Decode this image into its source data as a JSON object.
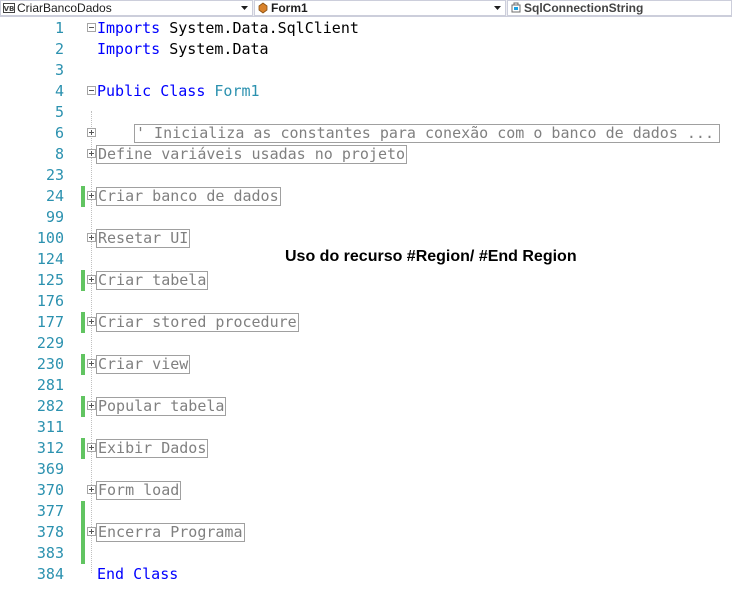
{
  "navbar": {
    "project_combo": "CriarBancoDados",
    "class_combo": "Form1",
    "member_combo": "SqlConnectionString",
    "project_icon": "vb-project-icon",
    "class_icon": "class-icon",
    "member_icon": "field-icon"
  },
  "editor": {
    "lines": [
      {
        "num": "1",
        "kw": "Imports",
        "rest": " System.Data.SqlClient"
      },
      {
        "num": "2",
        "kw": "Imports",
        "rest": " System.Data"
      },
      {
        "num": "3"
      },
      {
        "num": "4",
        "kw": "Public Class",
        "rest": " ",
        "name": "Form1"
      },
      {
        "num": "5"
      },
      {
        "num": "6",
        "collapsed": "' Inicializa as constantes para conexão com o banco de dados ..."
      },
      {
        "num": "8",
        "collapsed": "Define variáveis usadas no projeto"
      },
      {
        "num": "23"
      },
      {
        "num": "24",
        "collapsed": "Criar banco de dados"
      },
      {
        "num": "99"
      },
      {
        "num": "100",
        "collapsed": "Resetar UI"
      },
      {
        "num": "124"
      },
      {
        "num": "125",
        "collapsed": "Criar tabela"
      },
      {
        "num": "176"
      },
      {
        "num": "177",
        "collapsed": "Criar stored procedure"
      },
      {
        "num": "229"
      },
      {
        "num": "230",
        "collapsed": "Criar view"
      },
      {
        "num": "281"
      },
      {
        "num": "282",
        "collapsed": "Popular tabela"
      },
      {
        "num": "311"
      },
      {
        "num": "312",
        "collapsed": "Exibir Dados"
      },
      {
        "num": "369"
      },
      {
        "num": "370",
        "collapsed": "Form load"
      },
      {
        "num": "377"
      },
      {
        "num": "378",
        "collapsed": "Encerra Programa"
      },
      {
        "num": "383"
      },
      {
        "num": "384",
        "kw": "End Class"
      }
    ]
  },
  "annotation": "Uso do recurso #Region/ #End Region",
  "colors": {
    "keyword": "#0000ff",
    "type_name": "#2b91af",
    "line_number": "#2b91af",
    "collapsed_text": "#808080",
    "change_marker": "#61c461"
  }
}
